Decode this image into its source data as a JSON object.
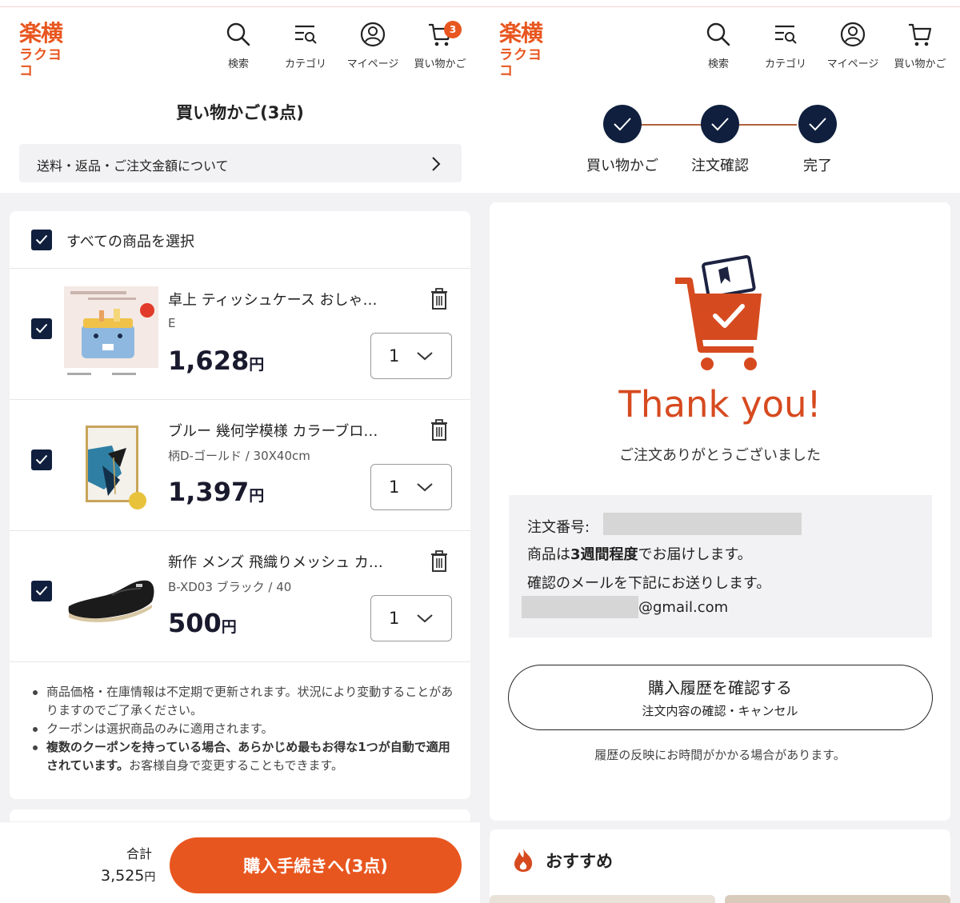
{
  "brand": {
    "logo_main": "楽横",
    "logo_sub": "ラクヨコ",
    "accent_color": "#e8561f",
    "navy_color": "#0f1f3d"
  },
  "nav": {
    "search": "検索",
    "category": "カテゴリ",
    "mypage": "マイページ",
    "cart": "買い物かご",
    "cart_count": "3"
  },
  "cart_page": {
    "title": "買い物かご(3点)",
    "info_link": "送料・返品・ご注文金額について",
    "select_all": "すべての商品を選択",
    "items": [
      {
        "name": "卓上 ティッシュケース おしゃ…",
        "variant": "E",
        "price": "1,628",
        "currency": "円",
        "qty": "1",
        "checked": true
      },
      {
        "name": "ブルー 幾何学模様 カラーブロ…",
        "variant": "柄D-ゴールド / 30X40cm",
        "price": "1,397",
        "currency": "円",
        "qty": "1",
        "checked": true
      },
      {
        "name": "新作 メンズ 飛織りメッシュ カ…",
        "variant": "B-XD03 ブラック / 40",
        "price": "500",
        "currency": "円",
        "qty": "1",
        "checked": true
      }
    ],
    "notes": {
      "n1": "商品価格・在庫情報は不定期で更新されます。状況により変動することがありますのでご了承ください。",
      "n2": "クーポンは選択商品のみに適用されます。",
      "n3_bold": "複数のクーポンを持っている場合、あらかじめ最もお得な1つが自動で適用されています。",
      "n3_rest": "お客様自身で変更することもできます。"
    },
    "total_label": "合計",
    "total_value": "3,525",
    "total_currency": "円",
    "checkout_button": "購入手続きへ(3点)"
  },
  "complete_page": {
    "steps": [
      "買い物かご",
      "注文確認",
      "完了"
    ],
    "thanks_title": "Thank you!",
    "thanks_sub": "ご注文ありがとうございました",
    "order_number_label": "注文番号:",
    "delivery_pre": "商品は",
    "delivery_bold": "3週間程度",
    "delivery_post": "でお届けします。",
    "mail_notice": "確認のメールを下記にお送りします。",
    "email_domain": "@gmail.com",
    "history_button_main": "購入履歴を確認する",
    "history_button_sub": "注文内容の確認・キャンセル",
    "history_note": "履歴の反映にお時間がかかる場合があります。",
    "recommend_title": "おすすめ"
  }
}
